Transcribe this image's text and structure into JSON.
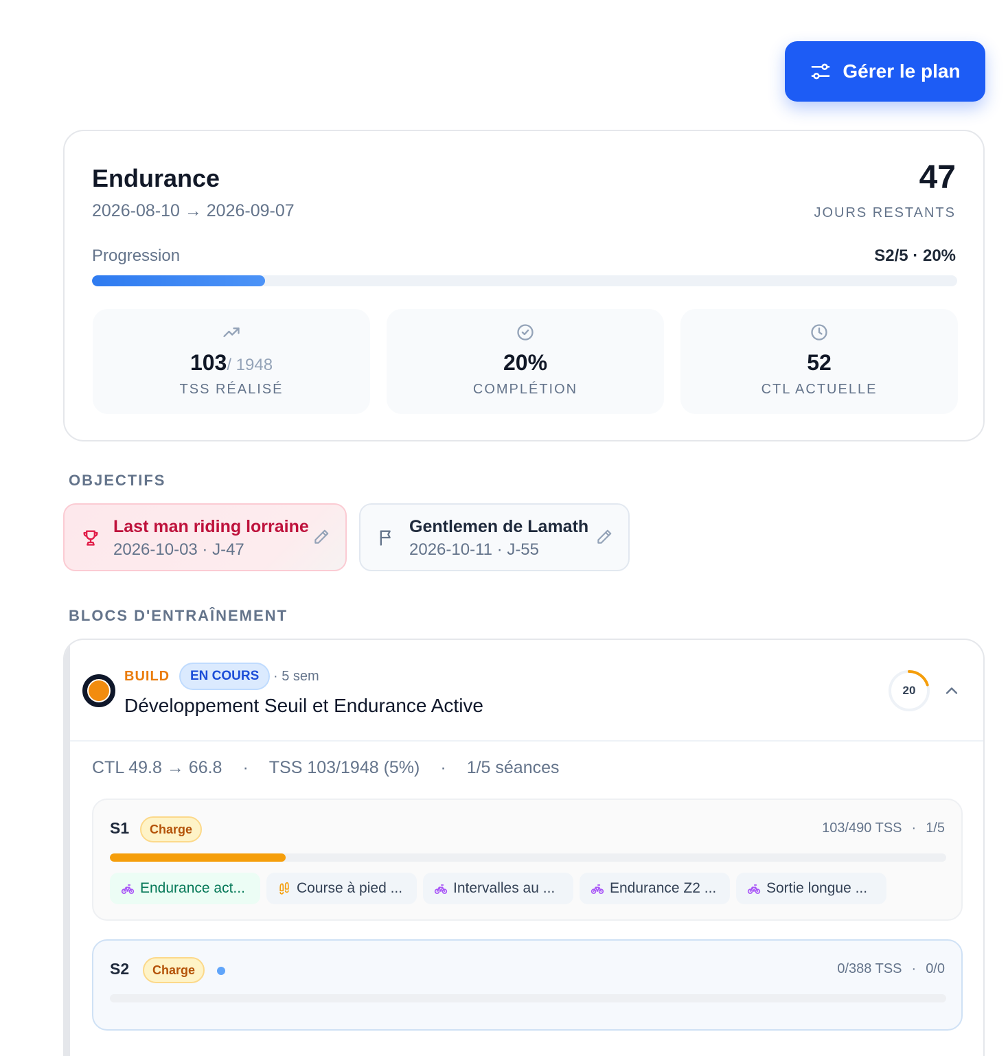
{
  "header": {
    "manage_button": "Gérer le plan"
  },
  "plan": {
    "title": "Endurance",
    "dates": "2026-08-10 → 2026-09-07",
    "days_remaining": "47",
    "days_label": "JOURS RESTANTS",
    "progress_label": "Progression",
    "progress_value": "S2/5 · 20%",
    "progress_fraction": 0.2,
    "stats": [
      {
        "icon": "trending-up-icon",
        "value": "103",
        "sub": "/ 1948",
        "label": "TSS RÉALISÉ"
      },
      {
        "icon": "check-circle-icon",
        "value": "20%",
        "sub": "",
        "label": "COMPLÉTION"
      },
      {
        "icon": "clock-icon",
        "value": "52",
        "sub": "",
        "label": "CTL ACTUELLE"
      }
    ]
  },
  "objectives": {
    "title": "OBJECTIFS",
    "items": [
      {
        "icon": "trophy-icon",
        "name": "Last man riding lorraine",
        "date": "2026-10-03 · J-47"
      },
      {
        "icon": "flag-icon",
        "name": "Gentlemen de Lamath",
        "date": "2026-10-11 · J-55"
      }
    ]
  },
  "blocks": {
    "title": "BLOCS D'ENTRAÎNEMENT",
    "block": {
      "phase": "BUILD",
      "status": "EN COURS",
      "duration": "· 5 sem",
      "name": "Développement Seuil et Endurance Active",
      "ring_value": "20",
      "ring_fraction": 0.2,
      "accent_color": "#f28c0f",
      "meta": {
        "ctl": "CTL 49.8 → 66.8",
        "sep": "·",
        "tss": "TSS 103/1948 (5%)",
        "sessions": "1/5 séances"
      },
      "weeks": [
        {
          "label": "S1",
          "badge": "Charge",
          "tss": "103/490 TSS",
          "sep": "·",
          "count": "1/5",
          "progress_fraction": 0.21,
          "sessions": [
            {
              "icon": "bike-icon",
              "label": "Endurance act...",
              "done": true
            },
            {
              "icon": "footprints-icon",
              "label": "Course à pied ...",
              "done": false
            },
            {
              "icon": "bike-icon",
              "label": "Intervalles au ...",
              "done": false
            },
            {
              "icon": "bike-icon",
              "label": "Endurance Z2 ...",
              "done": false
            },
            {
              "icon": "bike-icon",
              "label": "Sortie longue ...",
              "done": false
            }
          ]
        },
        {
          "label": "S2",
          "badge": "Charge",
          "tss": "0/388 TSS",
          "sep": "·",
          "count": "0/0",
          "progress_fraction": 0
        }
      ]
    }
  }
}
